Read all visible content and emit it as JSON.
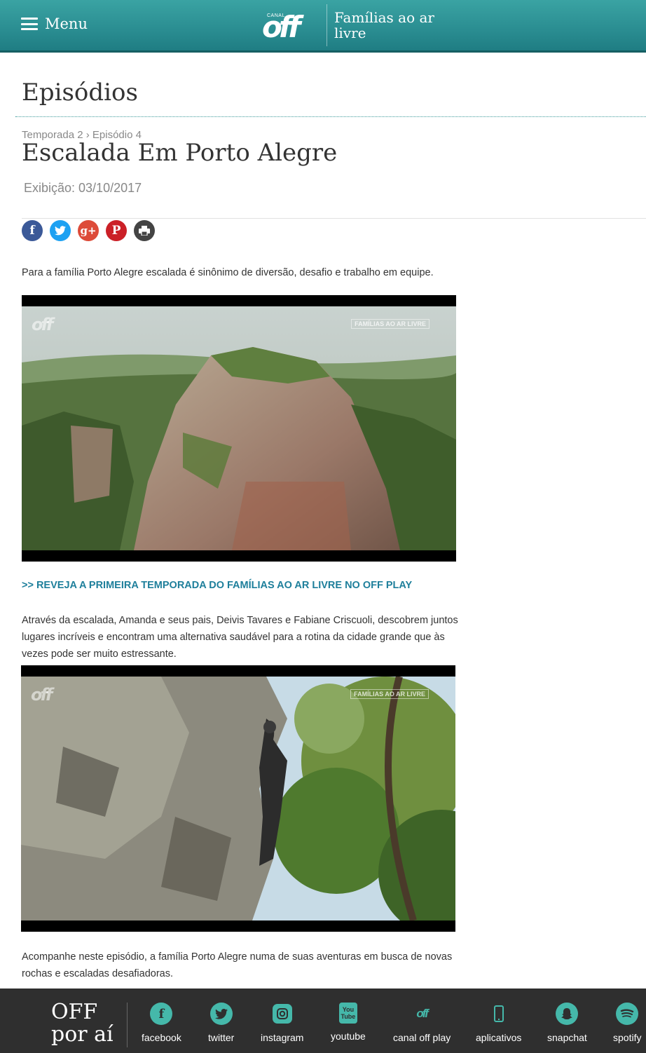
{
  "header": {
    "menu_label": "Menu",
    "logo_small": "CANAL",
    "logo_text": "off",
    "show_title": "Famílias ao ar livre"
  },
  "section_title": "Episódios",
  "episode": {
    "breadcrumb": "Temporada 2 › Episódio 4",
    "title": "Escalada Em Porto Alegre",
    "air_date": "Exibição: 03/10/2017"
  },
  "share": {
    "facebook": "f",
    "twitter": "t",
    "googleplus": "g+",
    "pinterest": "P",
    "print": "print"
  },
  "content": {
    "intro": "Para a família Porto Alegre escalada é sinônimo de diversão, desafio e trabalho em equipe.",
    "video1_watermark": "off",
    "video1_show": "FAMÍLIAS AO AR LIVRE",
    "link": ">> REVEJA A PRIMEIRA TEMPORADA DO FAMÍLIAS AO AR LIVRE NO OFF PLAY",
    "paragraph2": "Através da escalada, Amanda e seus pais, Deivis Tavares e Fabiane Criscuoli, descobrem juntos lugares incríveis e encontram uma alternativa saudável para a rotina da cidade grande que às vezes pode ser muito estressante.",
    "video2_watermark": "off",
    "video2_show": "FAMÍLIAS AO AR LIVRE",
    "paragraph3": "Acompanhe neste episódio, a família Porto Alegre numa de suas aventuras em busca de novas rochas e escaladas desafiadoras."
  },
  "footer": {
    "brand": "OFF por aí",
    "links": [
      {
        "label": "facebook",
        "icon": "facebook-icon"
      },
      {
        "label": "twitter",
        "icon": "twitter-icon"
      },
      {
        "label": "instagram",
        "icon": "instagram-icon"
      },
      {
        "label": "youtube",
        "icon": "youtube-icon"
      },
      {
        "label": "canal off play",
        "icon": "off-play-icon"
      },
      {
        "label": "aplicativos",
        "icon": "phone-icon"
      },
      {
        "label": "snapchat",
        "icon": "snapchat-icon"
      },
      {
        "label": "spotify",
        "icon": "spotify-icon"
      }
    ]
  },
  "colors": {
    "header_teal": "#2a8d91",
    "link_blue": "#1e7f9b",
    "footer_bg": "#2f2f2f",
    "footer_icon": "#45b8aa"
  }
}
